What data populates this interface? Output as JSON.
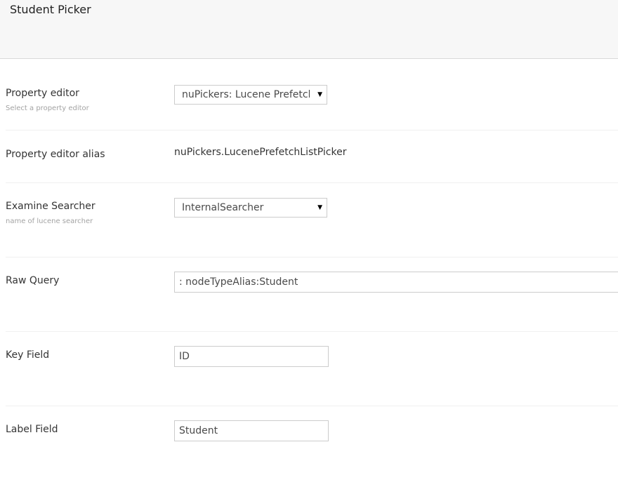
{
  "header": {
    "title": "Student Picker"
  },
  "fields": {
    "property_editor": {
      "label": "Property editor",
      "description": "Select a property editor",
      "selected": "nuPickers: Lucene PrefetchL"
    },
    "property_editor_alias": {
      "label": "Property editor alias",
      "value": "nuPickers.LucenePrefetchListPicker"
    },
    "examine_searcher": {
      "label": "Examine Searcher",
      "description": "name of lucene searcher",
      "selected": "InternalSearcher"
    },
    "raw_query": {
      "label": "Raw Query",
      "value": ": nodeTypeAlias:Student"
    },
    "key_field": {
      "label": "Key Field",
      "value": "ID"
    },
    "label_field": {
      "label": "Label Field",
      "value": "Student"
    }
  },
  "icons": {
    "dropdown": "caret-down-icon"
  }
}
